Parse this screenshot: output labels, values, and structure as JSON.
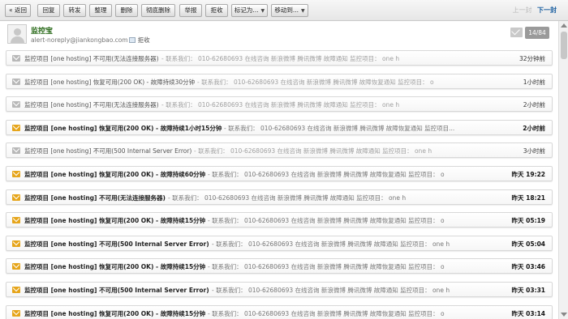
{
  "toolbar": {
    "back": "« 返回",
    "reply": "回复",
    "forward": "转发",
    "organize": "整理",
    "delete": "删除",
    "delete_permanent": "彻底删除",
    "report": "举报",
    "reject": "拒收",
    "mark_as": "标记为...",
    "move_to": "移动到...",
    "prev": "上一封",
    "next": "下一封"
  },
  "sender": {
    "name": "监控宝",
    "email": "alert-noreply@jiankongbao.com",
    "reject_link": "拒收",
    "counter": "14/84"
  },
  "messages": [
    {
      "status": "read",
      "subject": "监控项目 [one hosting] 不可用(无法连接服务器)",
      "snippet": "- 联系我们： 010-62680693 在线咨询 新浪微博 腾讯微博 故障通知 监控项目： one h",
      "time": "32分钟前"
    },
    {
      "status": "read",
      "subject": "监控项目 [one hosting] 恢复可用(200 OK) - 故障持续30分钟",
      "snippet": "- 联系我们： 010-62680693 在线咨询 新浪微博 腾讯微博 故障恢复通知 监控项目： o",
      "time": "1小时前"
    },
    {
      "status": "read",
      "subject": "监控项目 [one hosting] 不可用(无法连接服务器)",
      "snippet": "- 联系我们： 010-62680693 在线咨询 新浪微博 腾讯微博 故障通知 监控项目： one h",
      "time": "2小时前"
    },
    {
      "status": "unread",
      "subject": "监控项目 [one hosting] 恢复可用(200 OK) - 故障持续1小时15分钟",
      "snippet": "- 联系我们： 010-62680693 在线咨询 新浪微博 腾讯微博 故障恢复通知 监控项目...",
      "time": "2小时前"
    },
    {
      "status": "read",
      "subject": "监控项目 [one hosting] 不可用(500 Internal Server Error)",
      "snippet": "- 联系我们： 010-62680693 在线咨询 新浪微博 腾讯微博 故障通知 监控项目： one h",
      "time": "3小时前"
    },
    {
      "status": "unread",
      "subject": "监控项目 [one hosting] 恢复可用(200 OK) - 故障持续60分钟",
      "snippet": "- 联系我们： 010-62680693 在线咨询 新浪微博 腾讯微博 故障恢复通知 监控项目： o",
      "time": "昨天 19:22"
    },
    {
      "status": "unread",
      "subject": "监控项目 [one hosting] 不可用(无法连接服务器)",
      "snippet": "- 联系我们： 010-62680693 在线咨询 新浪微博 腾讯微博 故障通知 监控项目： one h",
      "time": "昨天 18:21"
    },
    {
      "status": "unread",
      "subject": "监控项目 [one hosting] 恢复可用(200 OK) - 故障持续15分钟",
      "snippet": "- 联系我们： 010-62680693 在线咨询 新浪微博 腾讯微博 故障恢复通知 监控项目： o",
      "time": "昨天 05:19"
    },
    {
      "status": "unread",
      "subject": "监控项目 [one hosting] 不可用(500 Internal Server Error)",
      "snippet": "- 联系我们： 010-62680693 在线咨询 新浪微博 腾讯微博 故障通知 监控项目： one h",
      "time": "昨天 05:04"
    },
    {
      "status": "unread",
      "subject": "监控项目 [one hosting] 恢复可用(200 OK) - 故障持续15分钟",
      "snippet": "- 联系我们： 010-62680693 在线咨询 新浪微博 腾讯微博 故障恢复通知 监控项目： o",
      "time": "昨天 03:46"
    },
    {
      "status": "unread",
      "subject": "监控项目 [one hosting] 不可用(500 Internal Server Error)",
      "snippet": "- 联系我们： 010-62680693 在线咨询 新浪微博 腾讯微博 故障通知 监控项目： one h",
      "time": "昨天 03:31"
    },
    {
      "status": "unread",
      "subject": "监控项目 [one hosting] 恢复可用(200 OK) - 故障持续15分钟",
      "snippet": "- 联系我们： 010-62680693 在线咨询 新浪微博 腾讯微博 故障恢复通知 监控项目： o",
      "time": "昨天 03:14"
    }
  ],
  "colors": {
    "unread_icon": "#e6a51b",
    "read_icon": "#b8b8b8",
    "sender_name": "#2a6a1a",
    "next_link": "#1a5fa0"
  }
}
